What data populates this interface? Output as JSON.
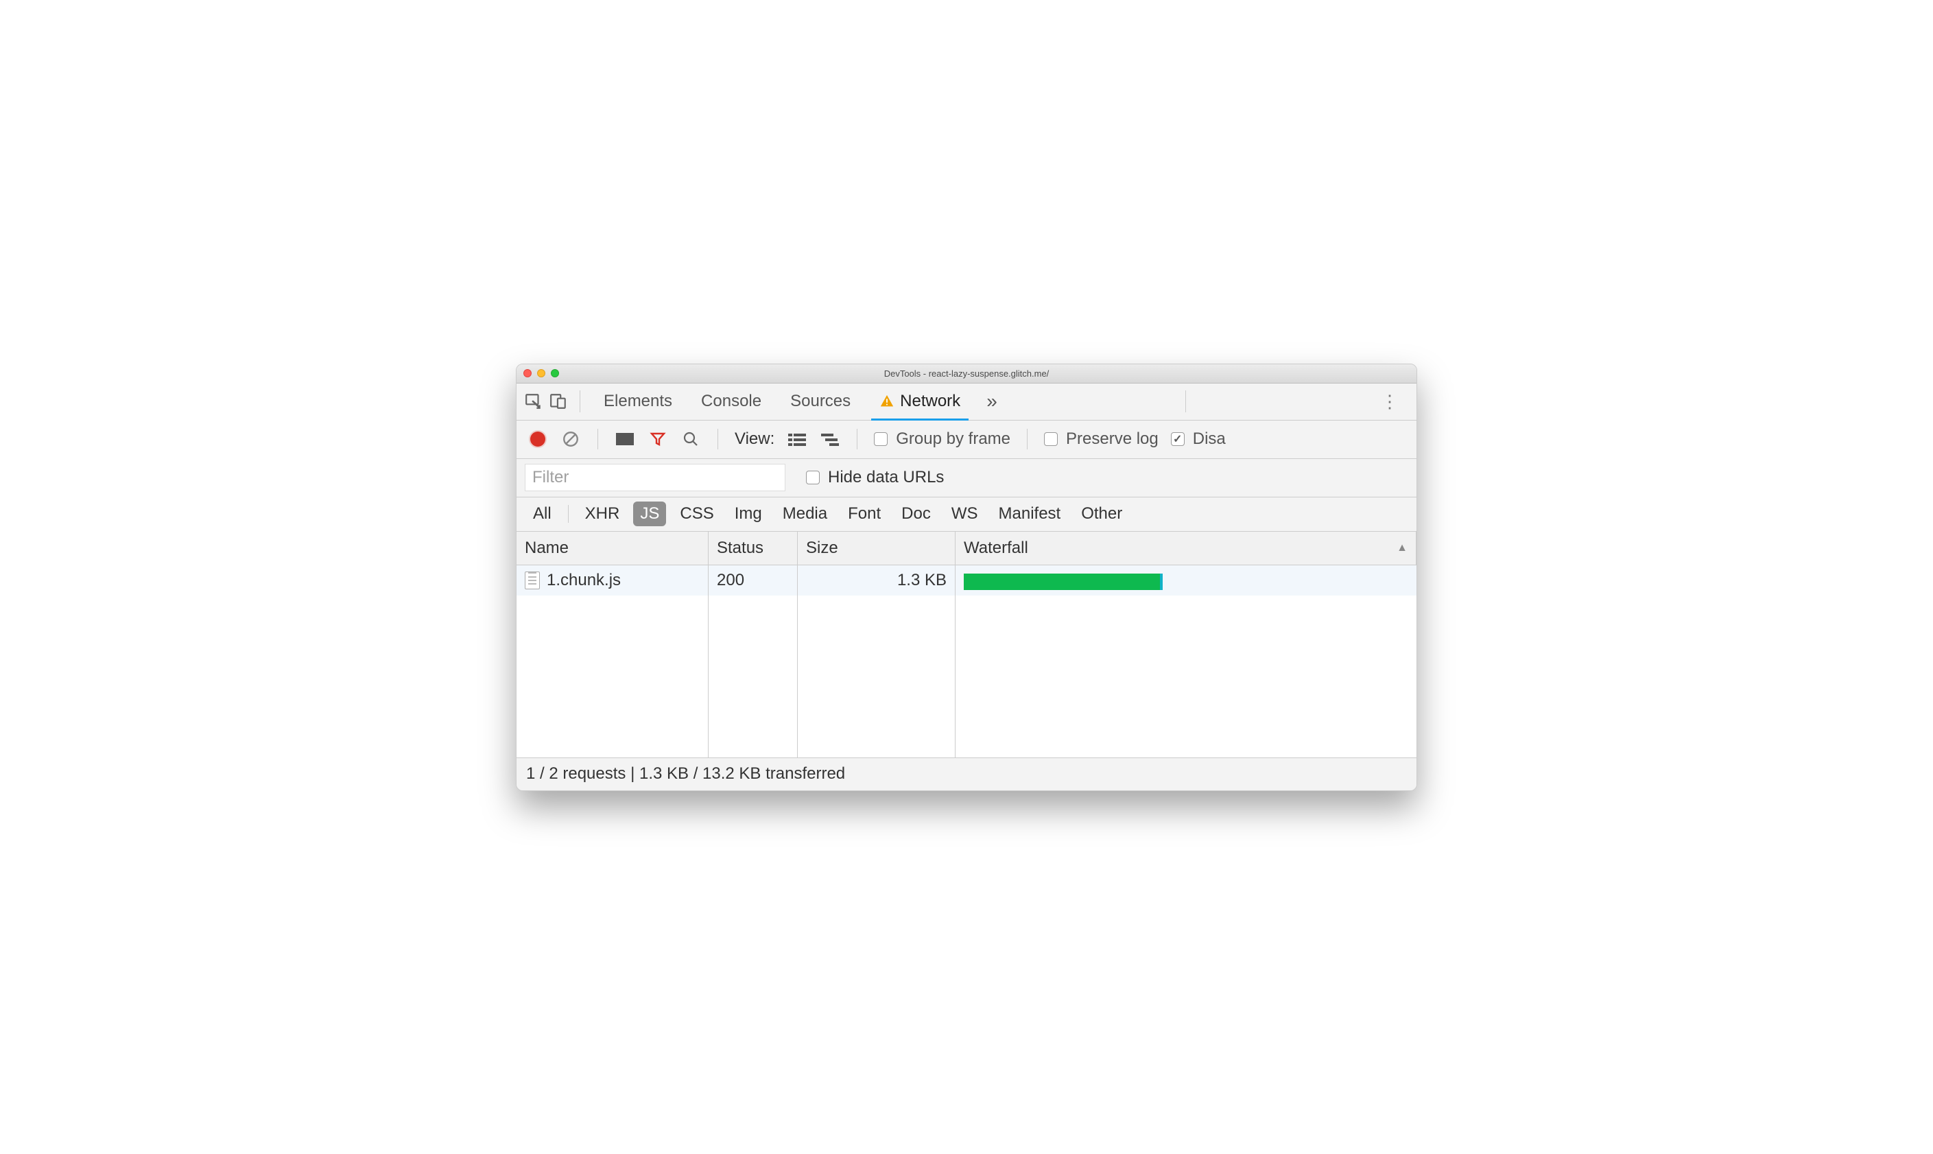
{
  "window": {
    "title": "DevTools - react-lazy-suspense.glitch.me/"
  },
  "tabs": {
    "items": [
      "Elements",
      "Console",
      "Sources",
      "Network"
    ],
    "active_index": 3
  },
  "toolbar": {
    "view_label": "View:",
    "group_by_frame": "Group by frame",
    "preserve_log": "Preserve log",
    "disable_cache": "Disa"
  },
  "filter": {
    "placeholder": "Filter",
    "hide_data_urls": "Hide data URLs"
  },
  "type_filters": [
    "All",
    "XHR",
    "JS",
    "CSS",
    "Img",
    "Media",
    "Font",
    "Doc",
    "WS",
    "Manifest",
    "Other"
  ],
  "type_filter_active_index": 2,
  "columns": {
    "name": "Name",
    "status": "Status",
    "size": "Size",
    "waterfall": "Waterfall"
  },
  "rows": [
    {
      "name": "1.chunk.js",
      "status": "200",
      "size": "1.3 KB"
    }
  ],
  "status": "1 / 2 requests | 1.3 KB / 13.2 KB transferred"
}
